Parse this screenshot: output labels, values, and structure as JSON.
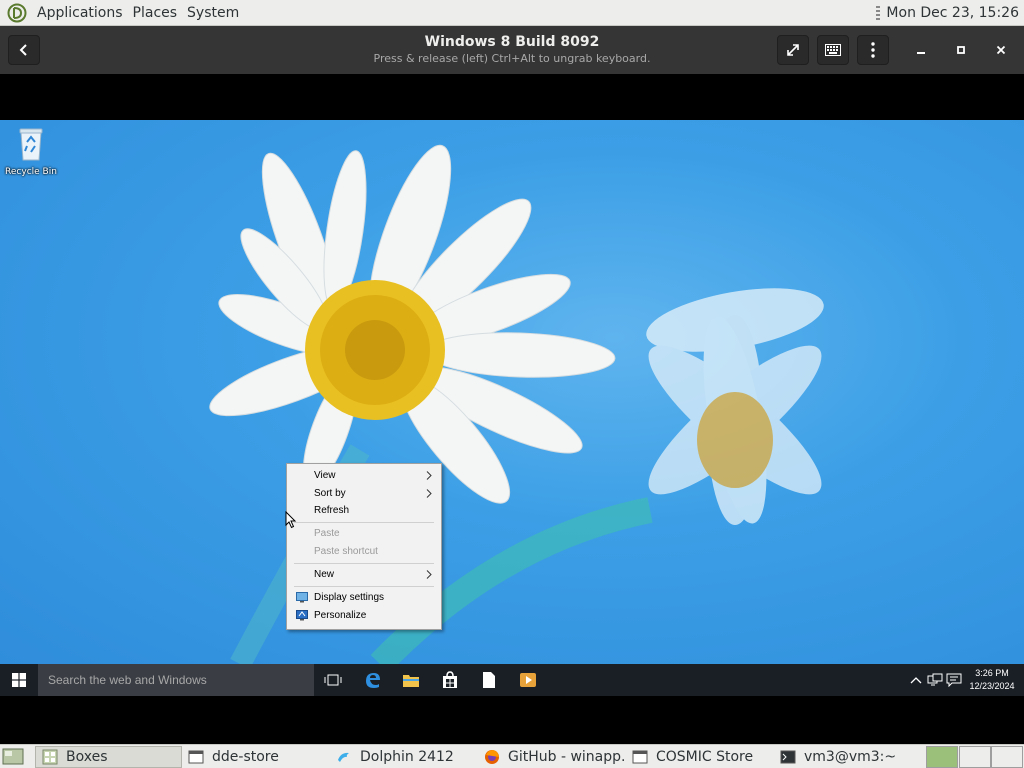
{
  "top_panel": {
    "menus": [
      "Applications",
      "Places",
      "System"
    ],
    "clock": "Mon Dec 23, 15:26"
  },
  "headerbar": {
    "title": "Windows 8 Build 8092",
    "subtitle": "Press & release (left) Ctrl+Alt to ungrab keyboard.",
    "icons": [
      "back-icon",
      "fullscreen-icon",
      "keyboard-icon",
      "menu-icon",
      "minimize-icon",
      "maximize-icon",
      "close-icon"
    ]
  },
  "desktop": {
    "icons": [
      {
        "label": "Recycle Bin",
        "icon": "recycle-bin-icon"
      }
    ]
  },
  "context_menu": {
    "items": [
      {
        "label": "View",
        "submenu": true,
        "disabled": false
      },
      {
        "label": "Sort by",
        "submenu": true,
        "disabled": false
      },
      {
        "label": "Refresh",
        "submenu": false,
        "disabled": false
      },
      {
        "label": "Paste",
        "submenu": false,
        "disabled": true
      },
      {
        "label": "Paste shortcut",
        "submenu": false,
        "disabled": true
      },
      {
        "label": "New",
        "submenu": true,
        "disabled": false
      },
      {
        "label": "Display settings",
        "submenu": false,
        "disabled": false,
        "icon": "display-icon"
      },
      {
        "label": "Personalize",
        "submenu": false,
        "disabled": false,
        "icon": "personalize-icon"
      }
    ]
  },
  "win_taskbar": {
    "search_placeholder": "Search the web and Windows",
    "pinned": [
      "task-view-icon",
      "edge-icon",
      "file-explorer-icon",
      "store-icon",
      "document-icon",
      "media-icon"
    ],
    "tray": [
      "chevron-up-icon",
      "network-icon",
      "notification-icon"
    ],
    "time": "3:26 PM",
    "date": "12/23/2024"
  },
  "bottom_panel": {
    "tasks": [
      {
        "label": "Boxes",
        "active": true
      },
      {
        "label": "dde-store",
        "active": false
      },
      {
        "label": "Dolphin 2412",
        "active": false
      },
      {
        "label": "GitHub - winapp...",
        "active": false
      },
      {
        "label": "COSMIC Store",
        "active": false
      },
      {
        "label": "vm3@vm3:~",
        "active": false
      }
    ],
    "workspaces": 3,
    "active_workspace": 1
  },
  "colors": {
    "panel_bg": "#ededeb",
    "headerbar_bg": "#353535",
    "desktop_blue": "#3c9fe6",
    "taskbar_bg": "#1a1f26",
    "workspace_active": "#9bc07a"
  }
}
